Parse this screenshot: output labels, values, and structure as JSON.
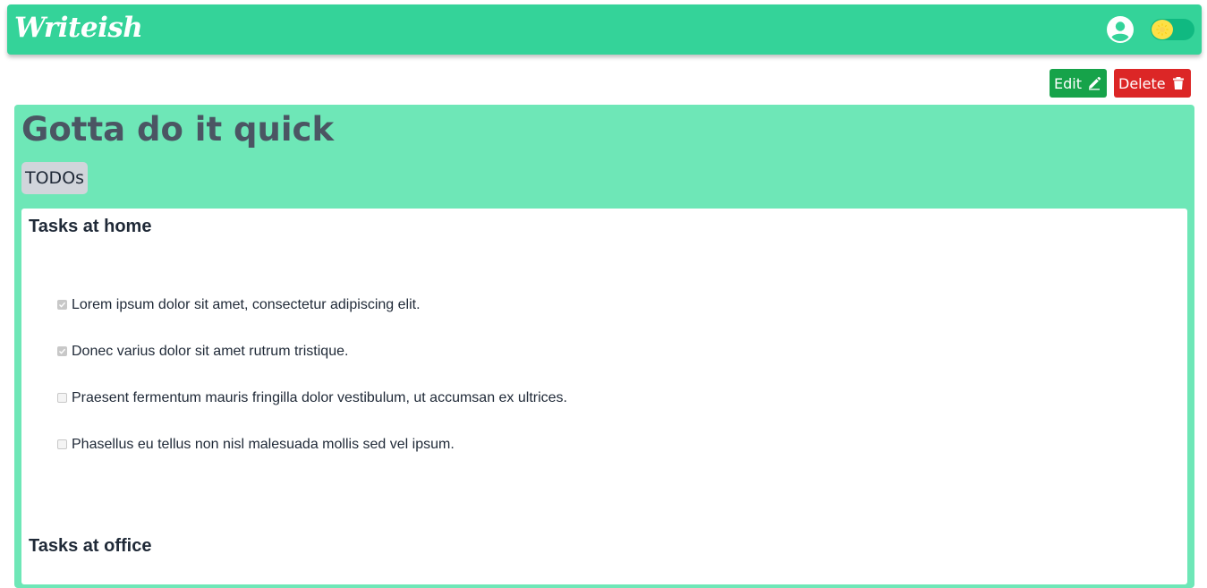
{
  "header": {
    "logo_text": "Writeish",
    "user_icon": "account-circle-icon",
    "theme_toggle_icon": "sun-icon",
    "brand_color": "#34d399"
  },
  "toolbar": {
    "edit_label": "Edit",
    "edit_icon": "pencil-icon",
    "delete_label": "Delete",
    "delete_icon": "trash-icon",
    "edit_color": "#16a34a",
    "delete_color": "#dc2626"
  },
  "note": {
    "title": "Gotta do it quick",
    "tag": "TODOs",
    "card_color": "#6ee7b7",
    "sections": [
      {
        "heading": "Tasks at home",
        "items": [
          {
            "text": "Lorem ipsum dolor sit amet, consectetur adipiscing elit.",
            "checked": true
          },
          {
            "text": "Donec varius dolor sit amet rutrum tristique.",
            "checked": true
          },
          {
            "text": "Praesent fermentum mauris fringilla dolor vestibulum, ut accumsan ex ultrices.",
            "checked": false
          },
          {
            "text": "Phasellus eu tellus non nisl malesuada mollis sed vel ipsum.",
            "checked": false
          }
        ]
      },
      {
        "heading": "Tasks at office",
        "items": []
      }
    ]
  }
}
